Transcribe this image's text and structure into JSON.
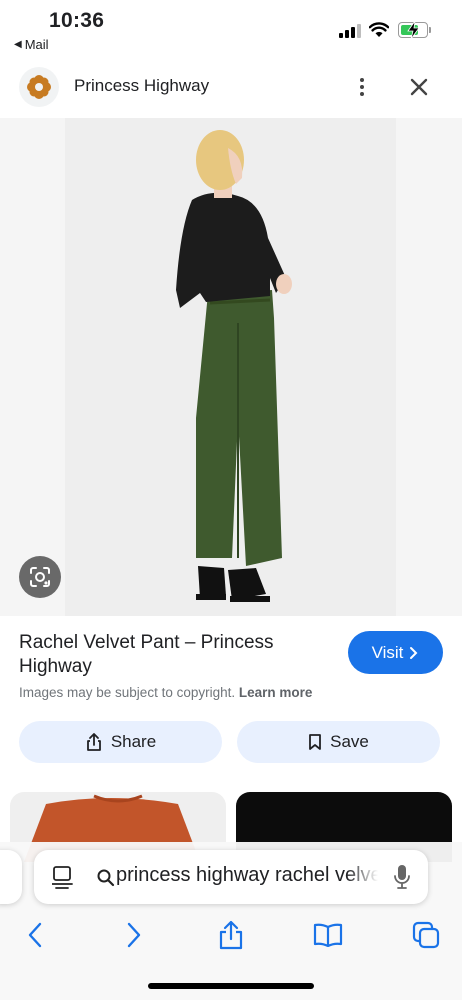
{
  "status_bar": {
    "time": "10:36",
    "back_app": "Mail",
    "icons": [
      "cellular-signal-icon",
      "wifi-icon",
      "battery-charging-icon"
    ]
  },
  "header": {
    "site_name": "Princess Highway",
    "logo_icon": "flower-logo",
    "menu_icon": "more-vert-icon",
    "close_icon": "close-icon"
  },
  "image": {
    "description_icon": "lens-icon",
    "colors": {
      "top": "#1c1c1c",
      "pants": "#3f5a2e",
      "hair": "#e7c77f",
      "background": "#eeeeee"
    }
  },
  "details": {
    "title": "Rachel Velvet Pant – Princess Highway",
    "visit_label": "Visit",
    "copyright_text": "Images may be subject to copyright.",
    "learn_more": "Learn more",
    "share_label": "Share",
    "save_label": "Save"
  },
  "related": {
    "thumb_colors": [
      "#c2552a",
      "#0c0c0c"
    ]
  },
  "browser": {
    "search_text": "princess highway rachel velvet pant",
    "toolbar_icons": [
      "back-icon",
      "forward-icon",
      "share-icon",
      "bookmarks-icon",
      "tabs-icon"
    ]
  },
  "colors": {
    "accent": "#1a73e8",
    "chip_bg": "#e8f0fe",
    "battery_green": "#34c759"
  }
}
